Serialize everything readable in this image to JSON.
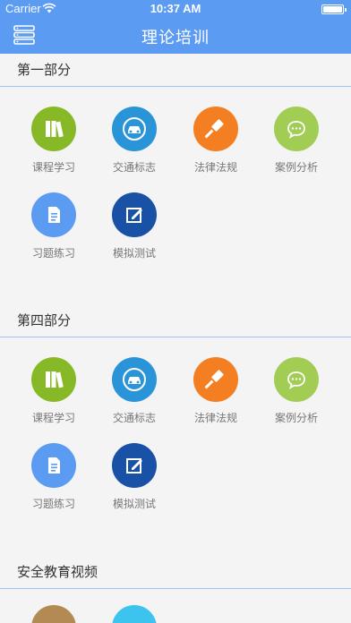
{
  "status": {
    "carrier": "Carrier",
    "time": "10:37 AM"
  },
  "nav": {
    "title": "理论培训"
  },
  "sections": [
    {
      "title": "第一部分",
      "items": [
        {
          "label": "课程学习",
          "icon": "books-icon",
          "color": "#87b927"
        },
        {
          "label": "交通标志",
          "icon": "car-icon",
          "color": "#2a94d8"
        },
        {
          "label": "法律法规",
          "icon": "gavel-icon",
          "color": "#f47f23"
        },
        {
          "label": "案例分析",
          "icon": "chat-bubble-icon",
          "color": "#a1cd55"
        },
        {
          "label": "习题练习",
          "icon": "document-icon",
          "color": "#5b9bf2"
        },
        {
          "label": "模拟测试",
          "icon": "edit-icon",
          "color": "#1851a6"
        }
      ]
    },
    {
      "title": "第四部分",
      "items": [
        {
          "label": "课程学习",
          "icon": "books-icon",
          "color": "#87b927"
        },
        {
          "label": "交通标志",
          "icon": "car-icon",
          "color": "#2a94d8"
        },
        {
          "label": "法律法规",
          "icon": "gavel-icon",
          "color": "#f47f23"
        },
        {
          "label": "案例分析",
          "icon": "chat-bubble-icon",
          "color": "#a1cd55"
        },
        {
          "label": "习题练习",
          "icon": "document-icon",
          "color": "#5b9bf2"
        },
        {
          "label": "模拟测试",
          "icon": "edit-icon",
          "color": "#1851a6"
        }
      ]
    },
    {
      "title": "安全教育视频",
      "items": [
        {
          "label": "",
          "icon": "video-icon",
          "color": "#b38a54"
        },
        {
          "label": "",
          "icon": "video-icon",
          "color": "#3cc4ef"
        }
      ]
    }
  ]
}
